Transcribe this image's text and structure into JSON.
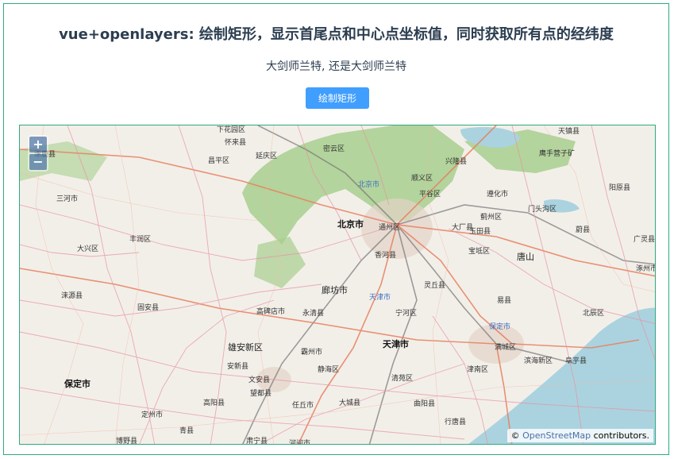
{
  "page": {
    "title": "vue+openlayers: 绘制矩形，显示首尾点和中心点坐标值，同时获取所有点的经纬度",
    "subtitle": "大剑师兰特, 还是大剑师兰特",
    "draw_button_label": "绘制矩形"
  },
  "map": {
    "zoom_in_label": "+",
    "zoom_out_label": "−",
    "attribution_prefix": "©",
    "attribution_link": "OpenStreetMap",
    "attribution_suffix": "contributors.",
    "colors": {
      "land": "#f2efe9",
      "forest": "#a8cf8e",
      "water": "#aad3df",
      "road": "#e892a2",
      "motorway": "#e87f5f",
      "rail": "#777777"
    },
    "place_labels": [
      {
        "name": "下花园区",
        "cls": ""
      },
      {
        "name": "怀来县",
        "cls": ""
      },
      {
        "name": "延庆区",
        "cls": ""
      },
      {
        "name": "密云区",
        "cls": ""
      },
      {
        "name": "兴隆县",
        "cls": ""
      },
      {
        "name": "鹰手营子矿",
        "cls": ""
      },
      {
        "name": "天镇县",
        "cls": ""
      },
      {
        "name": "涿鹿县",
        "cls": ""
      },
      {
        "name": "昌平区",
        "cls": ""
      },
      {
        "name": "北京市",
        "cls": "blue"
      },
      {
        "name": "顺义区",
        "cls": ""
      },
      {
        "name": "平谷区",
        "cls": ""
      },
      {
        "name": "遵化市",
        "cls": ""
      },
      {
        "name": "阳原县",
        "cls": ""
      },
      {
        "name": "三河市",
        "cls": ""
      },
      {
        "name": "蓟州区",
        "cls": ""
      },
      {
        "name": "门头沟区",
        "cls": ""
      },
      {
        "name": "北京市",
        "cls": "city"
      },
      {
        "name": "通州区",
        "cls": ""
      },
      {
        "name": "大厂县",
        "cls": ""
      },
      {
        "name": "玉田县",
        "cls": ""
      },
      {
        "name": "蔚县",
        "cls": ""
      },
      {
        "name": "丰润区",
        "cls": ""
      },
      {
        "name": "广灵县",
        "cls": ""
      },
      {
        "name": "大兴区",
        "cls": ""
      },
      {
        "name": "香河县",
        "cls": ""
      },
      {
        "name": "宝坻区",
        "cls": ""
      },
      {
        "name": "唐山",
        "cls": "big"
      },
      {
        "name": "涿州市",
        "cls": ""
      },
      {
        "name": "廊坊市",
        "cls": "big"
      },
      {
        "name": "灵丘县",
        "cls": ""
      },
      {
        "name": "涞源县",
        "cls": ""
      },
      {
        "name": "固安县",
        "cls": ""
      },
      {
        "name": "天津市",
        "cls": "blue"
      },
      {
        "name": "易县",
        "cls": ""
      },
      {
        "name": "高碑店市",
        "cls": ""
      },
      {
        "name": "永清县",
        "cls": ""
      },
      {
        "name": "宁河区",
        "cls": ""
      },
      {
        "name": "北辰区",
        "cls": ""
      },
      {
        "name": "保定市",
        "cls": "blue"
      },
      {
        "name": "雄安新区",
        "cls": "big"
      },
      {
        "name": "霸州市",
        "cls": ""
      },
      {
        "name": "天津市",
        "cls": "city"
      },
      {
        "name": "满城区",
        "cls": ""
      },
      {
        "name": "安新县",
        "cls": ""
      },
      {
        "name": "静海区",
        "cls": ""
      },
      {
        "name": "津南区",
        "cls": ""
      },
      {
        "name": "滨海新区",
        "cls": ""
      },
      {
        "name": "阜平县",
        "cls": ""
      },
      {
        "name": "保定市",
        "cls": "city"
      },
      {
        "name": "文安县",
        "cls": ""
      },
      {
        "name": "清苑区",
        "cls": ""
      },
      {
        "name": "望都县",
        "cls": ""
      },
      {
        "name": "高阳县",
        "cls": ""
      },
      {
        "name": "任丘市",
        "cls": ""
      },
      {
        "name": "大城县",
        "cls": ""
      },
      {
        "name": "曲阳县",
        "cls": ""
      },
      {
        "name": "定州市",
        "cls": ""
      },
      {
        "name": "青县",
        "cls": ""
      },
      {
        "name": "行唐县",
        "cls": ""
      },
      {
        "name": "博野县",
        "cls": ""
      },
      {
        "name": "肃宁县",
        "cls": ""
      },
      {
        "name": "河间市",
        "cls": ""
      }
    ]
  }
}
